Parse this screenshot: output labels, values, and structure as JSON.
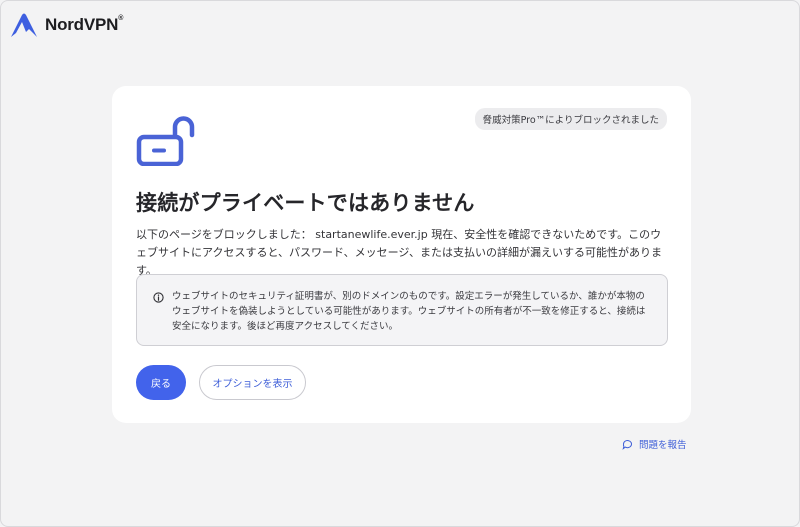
{
  "brand": {
    "name": "NordVPN",
    "trademark": "®",
    "logo_icon": "nordvpn-mountain-logo"
  },
  "card": {
    "badge": "脅威対策Pro™によりブロックされました",
    "lock_icon": "open-padlock-icon",
    "title": "接続がプライベートではありません",
    "description": "以下のページをブロックしました： startanewlife.ever.jp 現在、安全性を確認できないためです。このウェブサイトにアクセスすると、パスワード、メッセージ、または支払いの詳細が漏えいする可能性があります。",
    "info": {
      "icon": "info-circle-icon",
      "text": "ウェブサイトのセキュリティ証明書が、別のドメインのものです。設定エラーが発生しているか、誰かが本物のウェブサイトを偽装しようとしている可能性があります。ウェブサイトの所有者が不一致を修正すると、接続は安全になります。後ほど再度アクセスしてください。"
    },
    "back_label": "戻る",
    "options_label": "オプションを表示"
  },
  "report": {
    "icon": "chat-bubble-icon",
    "label": "問題を報告"
  },
  "colors": {
    "accent": "#4263eb",
    "link": "#3f5fd8",
    "page_bg": "#f3f3f4",
    "card_bg": "#ffffff",
    "lock_icon": "#4a63d6"
  }
}
